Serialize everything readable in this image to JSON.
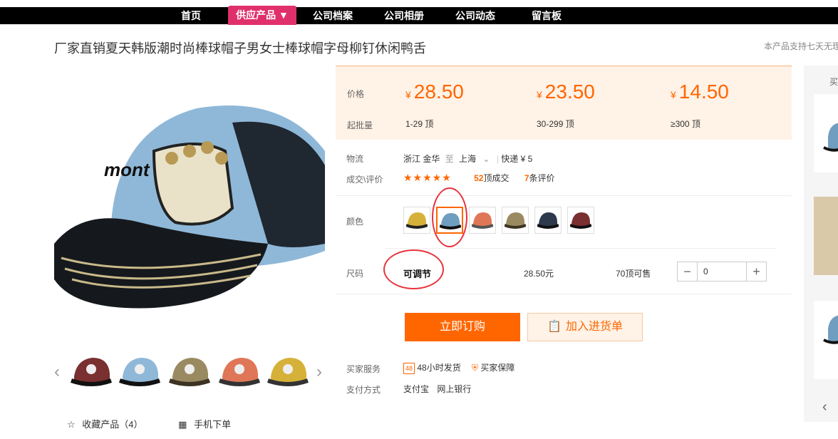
{
  "nav": {
    "items": [
      "首页",
      "供应产品 ▼",
      "公司档案",
      "公司相册",
      "公司动态",
      "留言板"
    ]
  },
  "product": {
    "title": "厂家直销夏天韩版潮时尚棒球帽子男女士棒球帽字母柳钉休闲鸭舌",
    "notice": "本产品支持七天无理"
  },
  "price": {
    "label": "价格",
    "moq_label": "起批量",
    "currency": "¥",
    "tiers": [
      {
        "price": "28.50",
        "range": "1-29 顶"
      },
      {
        "price": "23.50",
        "range": "30-299 顶"
      },
      {
        "price": "14.50",
        "range": "≥300 顶"
      }
    ]
  },
  "logistics": {
    "label": "物流",
    "from": "浙江 金华",
    "to_word": "至",
    "to": "上海",
    "express": "快递 ¥ 5"
  },
  "deals": {
    "label": "成交\\评价",
    "stars": "★★★★★",
    "sales_count": "52",
    "sales_text": "顶成交",
    "review_count": "7",
    "review_text": "条评价"
  },
  "color": {
    "label": "颜色",
    "swatches": [
      "yellow",
      "blue",
      "orange",
      "khaki",
      "navy",
      "red"
    ],
    "selected_index": 1
  },
  "size": {
    "label": "尺码",
    "value": "可调节",
    "price": "28.50元",
    "stock": "70顶可售",
    "quantity": "0",
    "minus": "−",
    "plus": "+"
  },
  "buttons": {
    "buy": "立即订购",
    "cart": "加入进货单"
  },
  "service": {
    "label": "买家服务",
    "item1": "48小时发货",
    "item2": "买家保障"
  },
  "payment": {
    "label": "支付方式",
    "item1": "支付宝",
    "item2": "网上银行"
  },
  "actions": {
    "favorite": "收藏产品（4）",
    "mobile": "手机下单"
  },
  "right": {
    "header": "买"
  },
  "colors": {
    "accent": "#ff6600",
    "nav_active": "#e0306b",
    "annotation": "#e8323c"
  }
}
